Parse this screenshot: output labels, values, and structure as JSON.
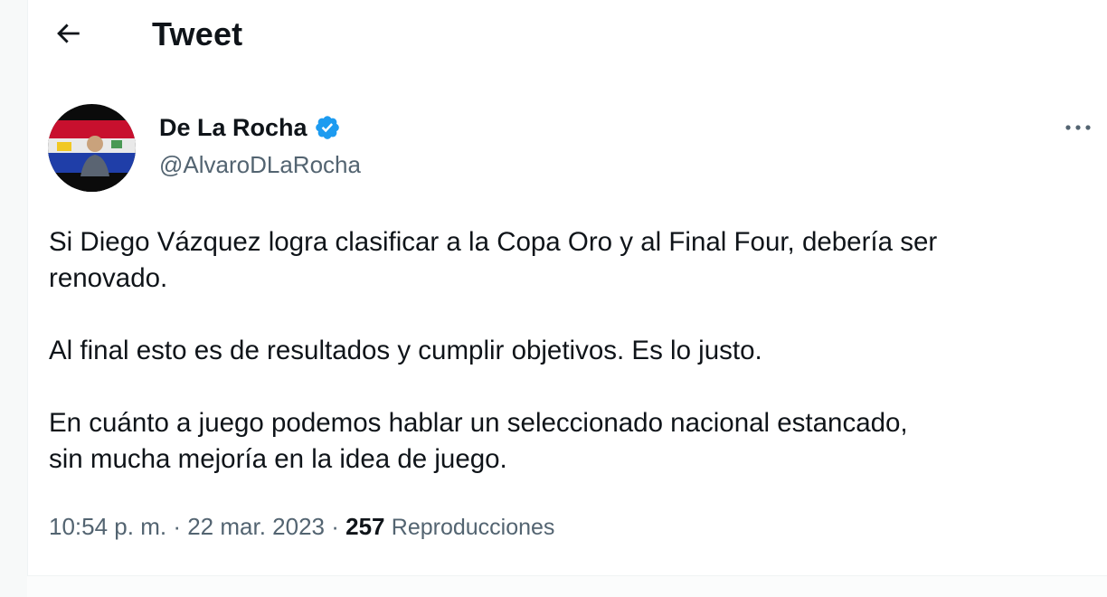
{
  "header": {
    "back_icon": "arrow-left-icon",
    "title": "Tweet"
  },
  "tweet": {
    "author": {
      "display_name": "De La Rocha",
      "handle": "@AlvaroDLaRocha",
      "verified_icon": "verified-badge-icon",
      "verified_color": "#1d9bf0"
    },
    "more_icon": "more-horizontal-icon",
    "paragraphs": [
      "Si Diego Vázquez logra clasificar a la Copa Oro y al Final Four, debería ser\nrenovado.",
      "Al final esto es de resultados y cumplir objetivos. Es lo justo.",
      "En cuánto a juego podemos hablar un seleccionado nacional estancado,\nsin mucha mejoría en la idea de juego."
    ],
    "meta": {
      "time": "10:54 p. m.",
      "separator": "·",
      "date": "22 mar. 2023",
      "views_count": "257",
      "views_label": "Reproducciones"
    }
  },
  "colors": {
    "text_primary": "#0f1419",
    "text_secondary": "#536471",
    "accent": "#1d9bf0"
  }
}
